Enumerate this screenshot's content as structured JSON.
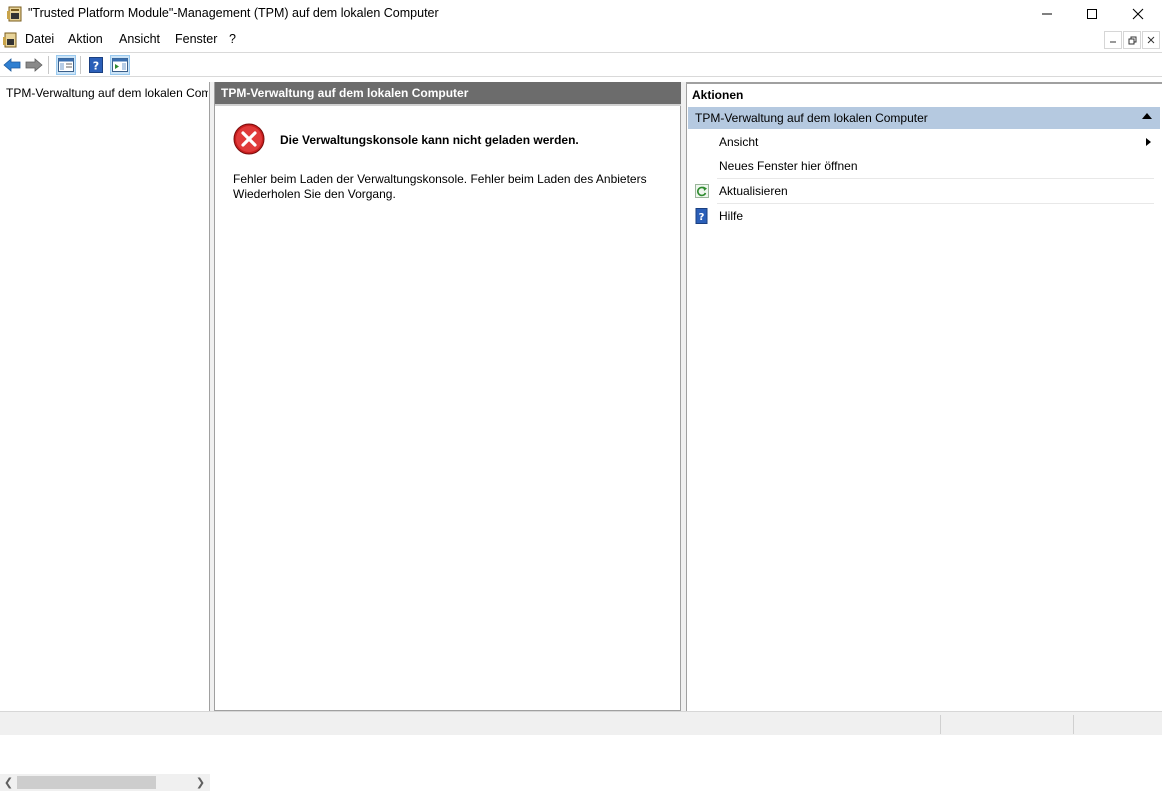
{
  "window": {
    "title": "\"Trusted Platform Module\"-Management (TPM) auf dem lokalen Computer",
    "minimize_glyph": "—",
    "maximize_glyph": "☐",
    "close_glyph": "✕"
  },
  "menubar": {
    "items": [
      "Datei",
      "Aktion",
      "Ansicht",
      "Fenster",
      "?"
    ]
  },
  "tree": {
    "root_label": "TPM-Verwaltung auf dem lokalen Computer"
  },
  "center": {
    "header": "TPM-Verwaltung auf dem lokalen Computer",
    "error_title": "Die Verwaltungskonsole kann nicht geladen werden.",
    "error_line1": "Fehler beim Laden der Verwaltungskonsole. Fehler beim Laden des Anbieters",
    "error_line2": "Wiederholen Sie den Vorgang."
  },
  "actions": {
    "header": "Aktionen",
    "group_title": "TPM-Verwaltung auf dem lokalen Computer",
    "items": [
      {
        "label": "Ansicht",
        "icon": "none",
        "submenu": true
      },
      {
        "label": "Neues Fenster hier öffnen",
        "icon": "none",
        "submenu": false
      },
      {
        "label": "Aktualisieren",
        "icon": "refresh-icon",
        "submenu": false
      },
      {
        "label": "Hilfe",
        "icon": "help-icon",
        "submenu": false
      }
    ]
  },
  "colors": {
    "center_header_bg": "#6c6c6c",
    "actions_group_bg": "#b5c9e0",
    "error_red": "#d32f2f"
  }
}
